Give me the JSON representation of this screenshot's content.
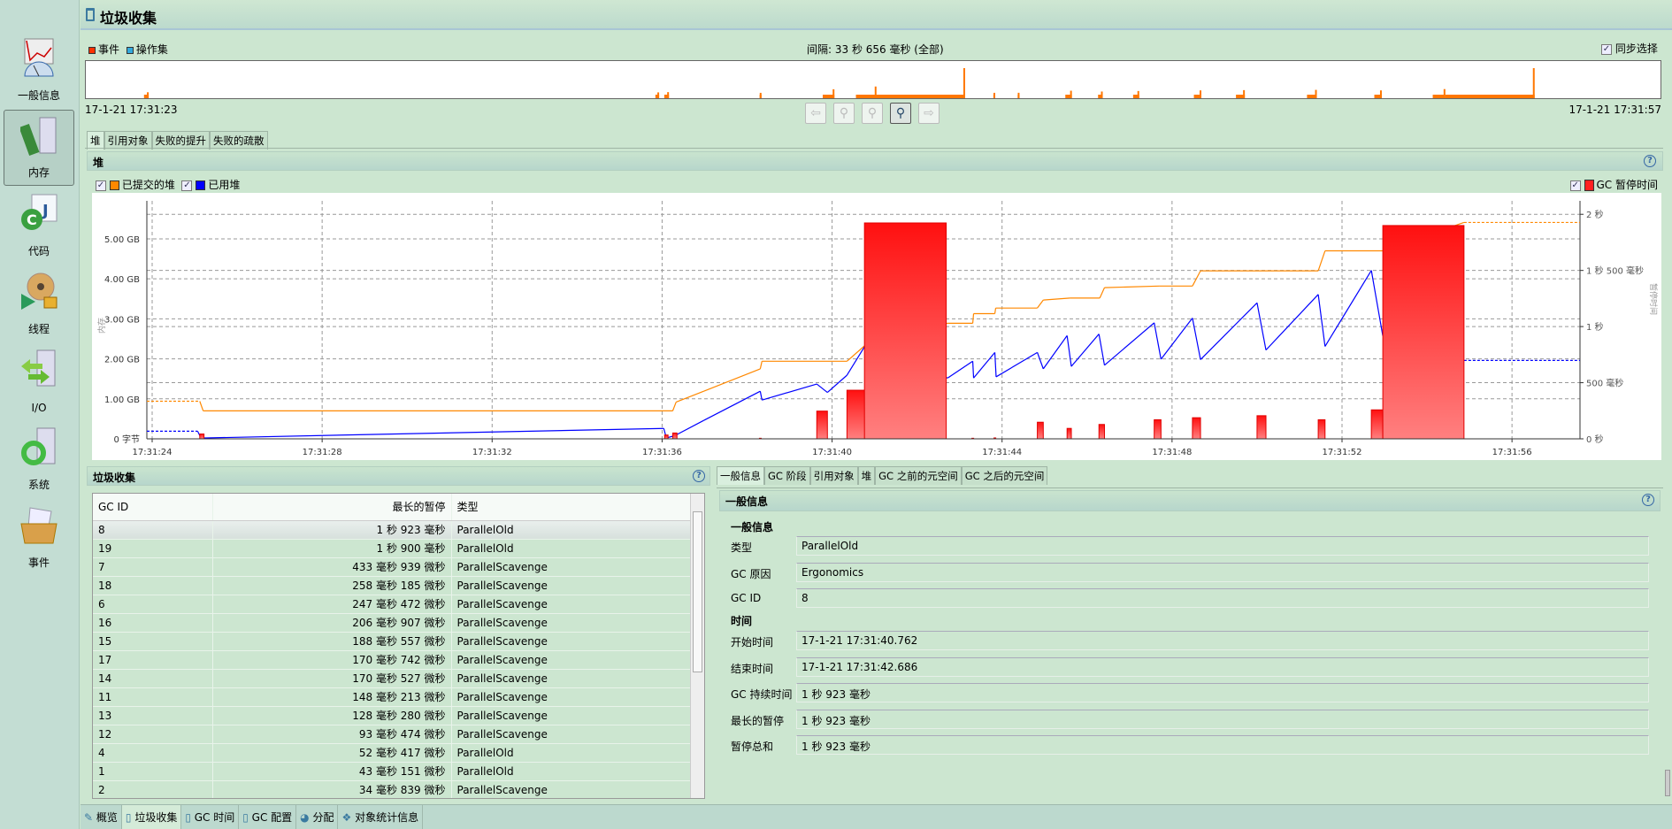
{
  "sidebar": {
    "items": [
      {
        "label": "一般信息",
        "icon": "general-info-icon"
      },
      {
        "label": "内存",
        "icon": "memory-icon",
        "active": true
      },
      {
        "label": "代码",
        "icon": "code-icon"
      },
      {
        "label": "线程",
        "icon": "threads-icon"
      },
      {
        "label": "I/O",
        "icon": "io-icon"
      },
      {
        "label": "系统",
        "icon": "system-icon"
      },
      {
        "label": "事件",
        "icon": "events-icon"
      }
    ]
  },
  "header": {
    "title": "垃圾收集"
  },
  "overview": {
    "legend": [
      {
        "label": "事件",
        "color": "#ff3300"
      },
      {
        "label": "操作集",
        "color": "#33aadd"
      }
    ],
    "interval": "间隔: 33 秒 656 毫秒 (全部)",
    "sync_label": "同步选择",
    "sync_checked": true,
    "start": "17-1-21 17:31:23",
    "end": "17-1-21 17:31:57",
    "event_color": "#ff7700"
  },
  "main_tabs": [
    {
      "label": "堆",
      "active": true
    },
    {
      "label": "引用对象"
    },
    {
      "label": "失败的提升"
    },
    {
      "label": "失败的疏散"
    }
  ],
  "heap_panel": {
    "title": "堆"
  },
  "chart_data": {
    "type": "line",
    "xlabel": "",
    "ylabel": "内存",
    "y2label": "暂停时间",
    "x_ticks": [
      "17:31:24",
      "17:31:28",
      "17:31:32",
      "17:31:36",
      "17:31:40",
      "17:31:44",
      "17:31:48",
      "17:31:52",
      "17:31:56"
    ],
    "x_range": [
      "17:31:23.875",
      "17:31:57.6"
    ],
    "y_ticks": [
      "0 字节",
      "1.00 GB",
      "2.00 GB",
      "3.00 GB",
      "4.00 GB",
      "5.00 GB"
    ],
    "y_range_gb": [
      0,
      5.95
    ],
    "y2_ticks": [
      "0 秒",
      "500 毫秒",
      "1 秒",
      "1 秒 500 毫秒",
      "2 秒"
    ],
    "y2_range_ms": [
      0,
      2120
    ],
    "grid": true,
    "series": [
      {
        "name": "已提交的堆",
        "color": "#ff8800",
        "checked": true,
        "unit": "GB",
        "points": [
          [
            "17:31:23.875",
            0.94
          ],
          [
            "17:31:25.12",
            0.94
          ],
          [
            "17:31:25.2",
            0.7
          ],
          [
            "17:31:36.25",
            0.7
          ],
          [
            "17:31:36.33",
            0.92
          ],
          [
            "17:31:36.98",
            1.19
          ],
          [
            "17:31:38.31",
            1.75
          ],
          [
            "17:31:38.35",
            1.94
          ],
          [
            "17:31:40.35",
            1.94
          ],
          [
            "17:31:40.79",
            2.35
          ],
          [
            "17:31:42.72",
            2.89
          ],
          [
            "17:31:43.31",
            2.89
          ],
          [
            "17:31:43.33",
            3.13
          ],
          [
            "17:31:43.83",
            3.13
          ],
          [
            "17:31:43.85",
            3.27
          ],
          [
            "17:31:44.83",
            3.27
          ],
          [
            "17:31:44.97",
            3.47
          ],
          [
            "17:31:45.6",
            3.52
          ],
          [
            "17:31:46.3",
            3.52
          ],
          [
            "17:31:46.41",
            3.78
          ],
          [
            "17:31:47.7",
            3.82
          ],
          [
            "17:31:48.48",
            3.82
          ],
          [
            "17:31:48.67",
            4.2
          ],
          [
            "17:31:51.44",
            4.2
          ],
          [
            "17:31:51.6",
            4.7
          ],
          [
            "17:31:52.96",
            4.7
          ],
          [
            "17:31:54.87",
            5.41
          ],
          [
            "17:31:57.6",
            5.41
          ]
        ]
      },
      {
        "name": "已用堆",
        "color": "#0000ff",
        "checked": true,
        "unit": "GB",
        "points": [
          [
            "17:31:23.875",
            0.19
          ],
          [
            "17:31:25.07",
            0.19
          ],
          [
            "17:31:25.15",
            0.02
          ],
          [
            "17:31:36.04",
            0.26
          ],
          [
            "17:31:36.1",
            0.02
          ],
          [
            "17:31:36.3",
            0.08
          ],
          [
            "17:31:36.98",
            0.46
          ],
          [
            "17:31:38.31",
            1.19
          ],
          [
            "17:31:38.35",
            0.97
          ],
          [
            "17:31:39.64",
            1.37
          ],
          [
            "17:31:39.89",
            1.16
          ],
          [
            "17:31:40.35",
            1.59
          ],
          [
            "17:31:40.79",
            2.35
          ],
          [
            "17:31:42.72",
            1.52
          ],
          [
            "17:31:43.31",
            1.94
          ],
          [
            "17:31:43.33",
            1.52
          ],
          [
            "17:31:43.83",
            2.16
          ],
          [
            "17:31:43.86",
            1.55
          ],
          [
            "17:31:44.83",
            2.16
          ],
          [
            "17:31:44.97",
            1.75
          ],
          [
            "17:31:45.53",
            2.58
          ],
          [
            "17:31:45.63",
            1.81
          ],
          [
            "17:31:46.28",
            2.62
          ],
          [
            "17:31:46.41",
            1.84
          ],
          [
            "17:31:47.58",
            2.9
          ],
          [
            "17:31:47.74",
            1.99
          ],
          [
            "17:31:48.48",
            3.02
          ],
          [
            "17:31:48.67",
            1.98
          ],
          [
            "17:31:50.0",
            3.4
          ],
          [
            "17:31:50.21",
            2.22
          ],
          [
            "17:31:51.44",
            3.61
          ],
          [
            "17:31:51.6",
            2.31
          ],
          [
            "17:31:52.69",
            4.21
          ],
          [
            "17:31:52.96",
            2.57
          ],
          [
            "17:31:54.87",
            1.96
          ],
          [
            "17:31:57.6",
            1.96
          ]
        ]
      }
    ],
    "bar_series": {
      "name": "GC 暂停时间",
      "color": "#ff2020",
      "checked": true,
      "unit": "ms",
      "bars": [
        [
          "17:31:25.12",
          "17:31:25.22",
          43
        ],
        [
          "17:31:36.06",
          "17:31:36.14",
          34
        ],
        [
          "17:31:36.25",
          "17:31:36.35",
          52
        ],
        [
          "17:31:38.29",
          "17:31:38.33",
          5
        ],
        [
          "17:31:39.64",
          "17:31:39.89",
          247
        ],
        [
          "17:31:40.35",
          "17:31:40.79",
          433
        ],
        [
          "17:31:40.762",
          "17:31:42.686",
          1923
        ],
        [
          "17:31:43.29",
          "17:31:43.33",
          5
        ],
        [
          "17:31:43.81",
          "17:31:43.85",
          8
        ],
        [
          "17:31:44.83",
          "17:31:44.97",
          148
        ],
        [
          "17:31:45.53",
          "17:31:45.63",
          93
        ],
        [
          "17:31:46.28",
          "17:31:46.41",
          128
        ],
        [
          "17:31:47.58",
          "17:31:47.74",
          170
        ],
        [
          "17:31:48.48",
          "17:31:48.67",
          188
        ],
        [
          "17:31:50.0",
          "17:31:50.21",
          206
        ],
        [
          "17:31:51.44",
          "17:31:51.6",
          170
        ],
        [
          "17:31:52.69",
          "17:31:52.96",
          258
        ],
        [
          "17:31:52.96",
          "17:31:54.87",
          1900
        ]
      ]
    }
  },
  "gc_table": {
    "title": "垃圾收集",
    "columns": [
      "GC ID",
      "最长的暂停",
      "类型"
    ],
    "rows": [
      [
        "8",
        "1 秒 923 毫秒",
        "ParallelOld"
      ],
      [
        "19",
        "1 秒 900 毫秒",
        "ParallelOld"
      ],
      [
        "7",
        "433 毫秒 939 微秒",
        "ParallelScavenge"
      ],
      [
        "18",
        "258 毫秒 185 微秒",
        "ParallelScavenge"
      ],
      [
        "6",
        "247 毫秒 472 微秒",
        "ParallelScavenge"
      ],
      [
        "16",
        "206 毫秒 907 微秒",
        "ParallelScavenge"
      ],
      [
        "15",
        "188 毫秒 557 微秒",
        "ParallelScavenge"
      ],
      [
        "17",
        "170 毫秒 742 微秒",
        "ParallelScavenge"
      ],
      [
        "14",
        "170 毫秒 527 微秒",
        "ParallelScavenge"
      ],
      [
        "11",
        "148 毫秒 213 微秒",
        "ParallelScavenge"
      ],
      [
        "13",
        "128 毫秒 280 微秒",
        "ParallelScavenge"
      ],
      [
        "12",
        "93 毫秒 474 微秒",
        "ParallelScavenge"
      ],
      [
        "4",
        "52 毫秒 417 微秒",
        "ParallelOld"
      ],
      [
        "1",
        "43 毫秒 151 微秒",
        "ParallelOld"
      ],
      [
        "2",
        "34 毫秒 839 微秒",
        "ParallelScavenge"
      ]
    ]
  },
  "detail": {
    "tabs": [
      {
        "label": "一般信息",
        "active": true
      },
      {
        "label": "GC 阶段"
      },
      {
        "label": "引用对象"
      },
      {
        "label": "堆"
      },
      {
        "label": "GC 之前的元空间"
      },
      {
        "label": "GC 之后的元空间"
      }
    ],
    "title": "一般信息",
    "section_general": "一般信息",
    "section_time": "时间",
    "general": [
      {
        "label": "类型",
        "value": "ParallelOld"
      },
      {
        "label": "GC 原因",
        "value": "Ergonomics"
      },
      {
        "label": "GC ID",
        "value": "8"
      }
    ],
    "time": [
      {
        "label": "开始时间",
        "value": "17-1-21 17:31:40.762"
      },
      {
        "label": "结束时间",
        "value": "17-1-21 17:31:42.686"
      },
      {
        "label": "GC 持续时间",
        "value": "1 秒 923 毫秒"
      },
      {
        "label": "最长的暂停",
        "value": "1 秒 923 毫秒"
      },
      {
        "label": "暂停总和",
        "value": "1 秒 923 毫秒"
      }
    ]
  },
  "bottom_tabs": [
    {
      "label": "概览"
    },
    {
      "label": "垃圾收集",
      "active": true
    },
    {
      "label": "GC 时间"
    },
    {
      "label": "GC 配置"
    },
    {
      "label": "分配"
    },
    {
      "label": "对象统计信息"
    }
  ]
}
